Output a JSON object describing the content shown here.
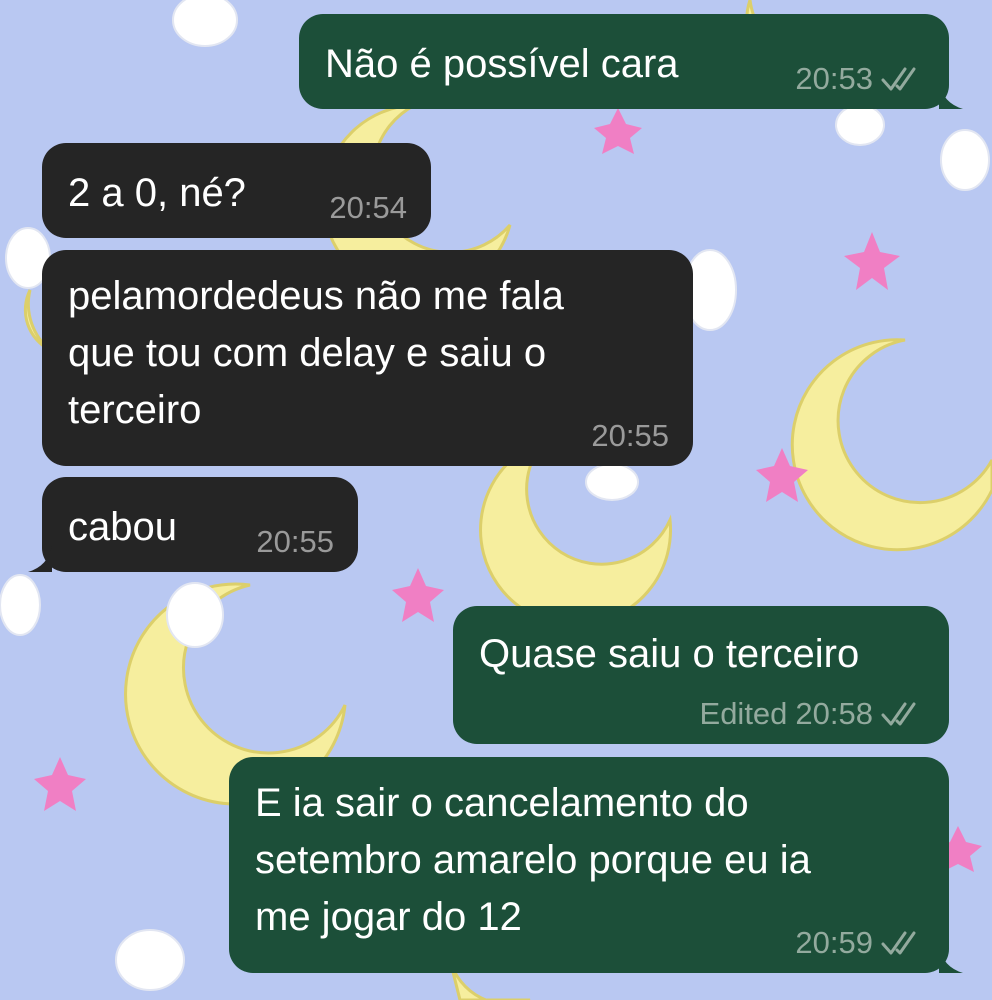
{
  "colors": {
    "wallpaper": "#b9c8f2",
    "incoming_bubble": "#252525",
    "outgoing_bubble": "#1c4f39",
    "moon": "#f6ee9e",
    "star": "#f07fc4"
  },
  "messages": [
    {
      "direction": "outgoing",
      "text": "Não é possível cara",
      "time": "20:53",
      "status_icon": "double-check-icon"
    },
    {
      "direction": "incoming",
      "text": "2 a 0, né?",
      "time": "20:54"
    },
    {
      "direction": "incoming",
      "text": "pelamordedeus não me fala\nque tou com delay e saiu o\nterceiro",
      "time": "20:55"
    },
    {
      "direction": "incoming",
      "text": "cabou",
      "time": "20:55"
    },
    {
      "direction": "outgoing",
      "text": "Quase saiu o terceiro",
      "edited_label": "Edited",
      "time": "20:58",
      "status_icon": "double-check-icon"
    },
    {
      "direction": "outgoing",
      "text": "E ia sair o cancelamento do\nsetembro amarelo porque eu ia\nme jogar do 12",
      "time": "20:59",
      "status_icon": "double-check-icon"
    }
  ]
}
